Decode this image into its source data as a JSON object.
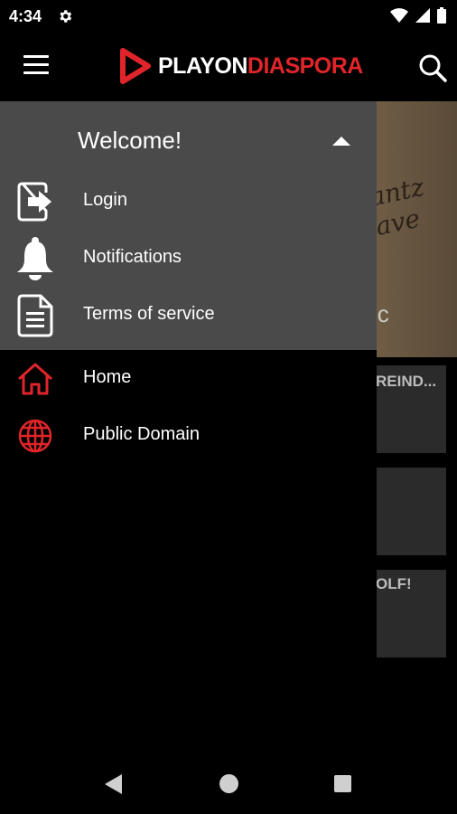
{
  "status_bar": {
    "time": "4:34"
  },
  "app_bar": {
    "logo": {
      "part1": "PLAYON",
      "part2": "DIASPORA"
    }
  },
  "background": {
    "hero_text": "ic",
    "hero_script": "antz ave",
    "cards": [
      {
        "title": "REIND..."
      },
      {
        "title": ""
      },
      {
        "title": "OLF!"
      }
    ]
  },
  "drawer": {
    "header_title": "Welcome!",
    "account_items": [
      {
        "label": "Login",
        "icon": "login-icon"
      },
      {
        "label": "Notifications",
        "icon": "bell-icon"
      },
      {
        "label": "Terms of service",
        "icon": "document-icon"
      }
    ],
    "nav_items": [
      {
        "label": "Home",
        "icon": "home-icon"
      },
      {
        "label": "Public Domain",
        "icon": "globe-icon"
      }
    ]
  },
  "colors": {
    "accent": "#e0252a",
    "drawer_header": "#4a4a4a",
    "background": "#000000"
  }
}
